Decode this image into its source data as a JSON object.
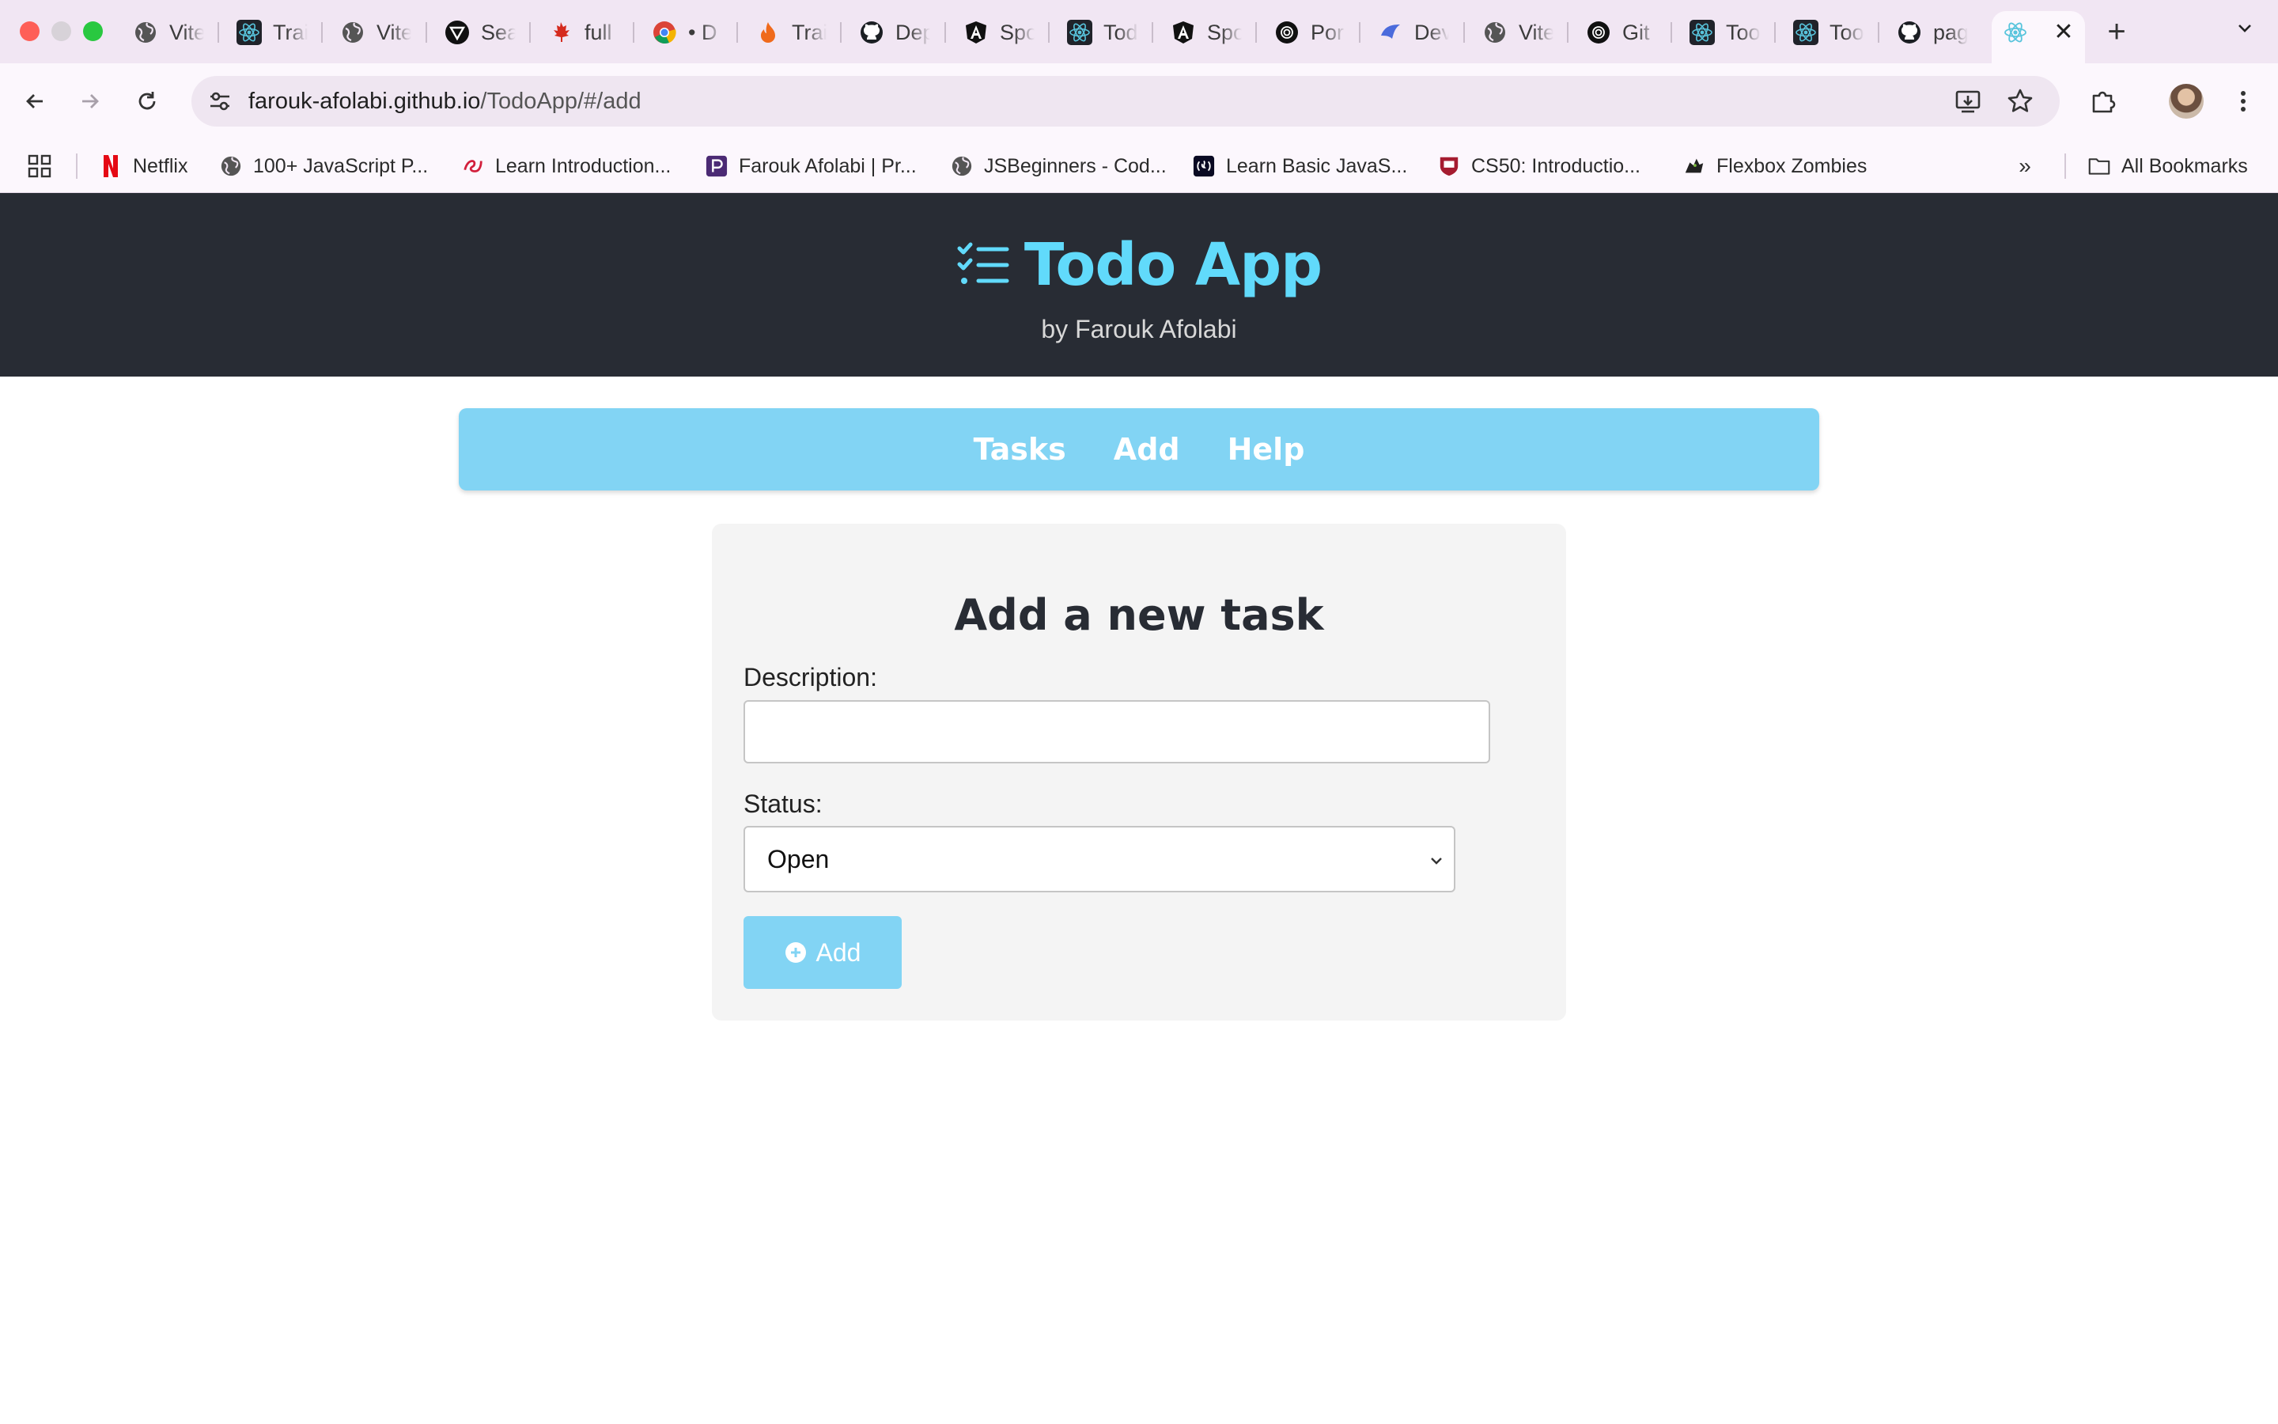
{
  "browser": {
    "tabs": [
      {
        "title": "Vite",
        "icon": "globe-icon"
      },
      {
        "title": "Trai",
        "icon": "react-icon"
      },
      {
        "title": "Vite",
        "icon": "globe-icon"
      },
      {
        "title": "Sea",
        "icon": "vectorpea-icon"
      },
      {
        "title": "full",
        "icon": "maple-leaf-icon"
      },
      {
        "title": "• D",
        "icon": "chrome-icon"
      },
      {
        "title": "Trai",
        "icon": "flame-icon"
      },
      {
        "title": "Dep",
        "icon": "github-icon"
      },
      {
        "title": "Spo",
        "icon": "angular-icon"
      },
      {
        "title": "Tod",
        "icon": "react-icon"
      },
      {
        "title": "Spo",
        "icon": "angular-icon"
      },
      {
        "title": "Por",
        "icon": "openai-icon"
      },
      {
        "title": "Dev",
        "icon": "devin-icon"
      },
      {
        "title": "Vite",
        "icon": "globe-icon"
      },
      {
        "title": "Git",
        "icon": "openai-icon"
      },
      {
        "title": "Too",
        "icon": "react-icon"
      },
      {
        "title": "Too",
        "icon": "react-icon"
      },
      {
        "title": "pag",
        "icon": "github-icon"
      }
    ],
    "active_tab": {
      "icon": "react-icon",
      "close": "✕"
    },
    "new_tab": "+",
    "url_host": "farouk-afolabi.github.io",
    "url_path": "/TodoApp/#/add",
    "bookmarks": [
      {
        "label": "Netflix",
        "icon": "netflix-icon"
      },
      {
        "label": "100+ JavaScript P...",
        "icon": "globe-icon"
      },
      {
        "label": "Learn Introduction...",
        "icon": "codecademy-icon"
      },
      {
        "label": "Farouk Afolabi | Pr...",
        "icon": "portfolio-icon"
      },
      {
        "label": "JSBeginners - Cod...",
        "icon": "globe-icon"
      },
      {
        "label": "Learn Basic JavaS...",
        "icon": "freecodecamp-icon"
      },
      {
        "label": "CS50: Introductio...",
        "icon": "harvard-icon"
      },
      {
        "label": "Flexbox Zombies",
        "icon": "zombie-icon"
      }
    ],
    "bookmarks_more": "»",
    "all_bookmarks": "All Bookmarks"
  },
  "app": {
    "title": "Todo App",
    "byline": "by Farouk Afolabi",
    "nav": [
      "Tasks",
      "Add",
      "Help"
    ],
    "form": {
      "heading": "Add a new task",
      "description_label": "Description:",
      "description_value": "",
      "status_label": "Status:",
      "status_value": "Open",
      "submit_label": "Add"
    }
  },
  "colors": {
    "header_bg": "#282c34",
    "accent": "#61dafb",
    "nav_bg": "#82d4f4",
    "card_bg": "#f4f4f4"
  }
}
